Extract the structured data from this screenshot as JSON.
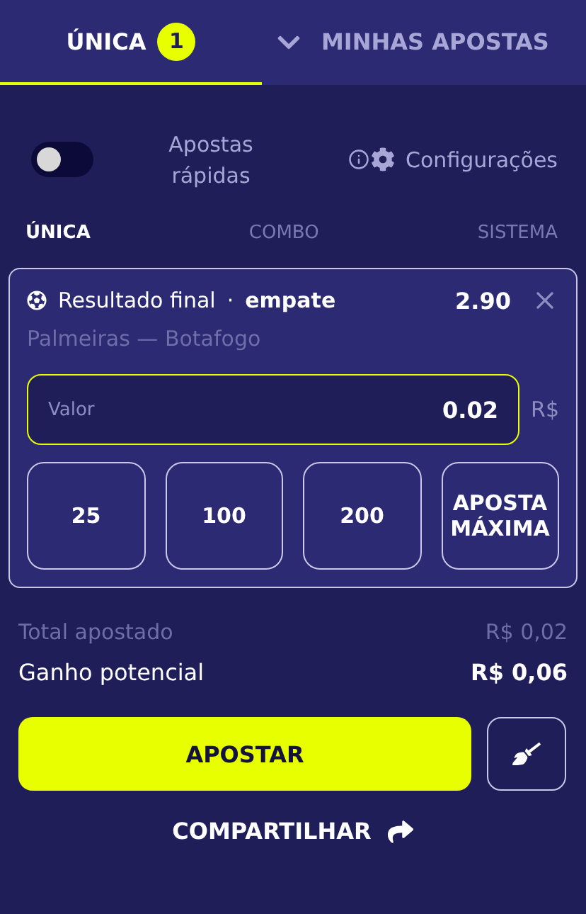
{
  "header": {
    "tabs": [
      {
        "label": "ÚNICA",
        "badge": "1",
        "selected": true
      },
      {
        "label": "MINHAS APOSTAS",
        "selected": false
      }
    ]
  },
  "quick_bets": {
    "label": "Apostas rápidas",
    "on": false
  },
  "settings": {
    "label": "Configurações"
  },
  "bet_types": [
    {
      "label": "ÚNICA",
      "selected": true
    },
    {
      "label": "COMBO",
      "selected": false
    },
    {
      "label": "SISTEMA",
      "selected": false
    }
  ],
  "bet": {
    "market": "Resultado final",
    "separator": "·",
    "selection": "empate",
    "odds": "2.90",
    "match": "Palmeiras — Botafogo",
    "stake": {
      "label": "Valor",
      "value": "0.02",
      "currency": "R$"
    },
    "quick_amounts": [
      "25",
      "100",
      "200",
      "APOSTA MÁXIMA"
    ]
  },
  "summary": [
    {
      "label": "Total apostado",
      "value": "R$ 0,02",
      "kind": "muted"
    },
    {
      "label": "Ganho potencial",
      "value": "R$ 0,06",
      "kind": "strong"
    }
  ],
  "place_button": "APOSTAR",
  "share": "COMPARTILHAR"
}
